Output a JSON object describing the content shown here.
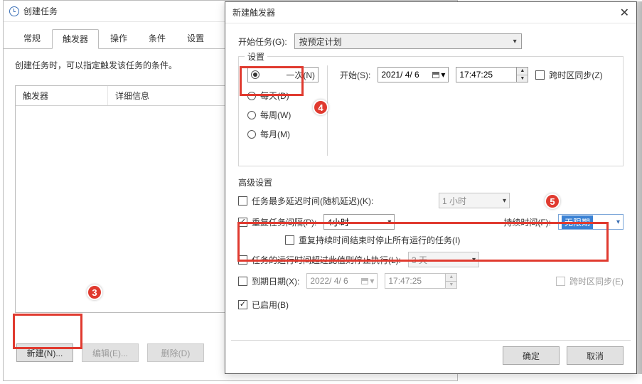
{
  "back": {
    "title": "创建任务",
    "tabs": [
      "常规",
      "触发器",
      "操作",
      "条件",
      "设置"
    ],
    "active_tab": 1,
    "hint": "创建任务时，可以指定触发该任务的条件。",
    "col_trigger": "触发器",
    "col_detail": "详细信息",
    "btn_new": "新建(N)...",
    "btn_edit": "编辑(E)...",
    "btn_delete": "删除(D)"
  },
  "front": {
    "title": "新建触发器",
    "begin_label": "开始任务(G):",
    "begin_value": "按预定计划",
    "settings_legend": "设置",
    "freq": {
      "once": "一次(N)",
      "daily": "每天(D)",
      "weekly": "每周(W)",
      "monthly": "每月(M)"
    },
    "start_label": "开始(S):",
    "start_date": "2021/ 4/ 6",
    "start_time": "17:47:25",
    "cross_tz": "跨时区同步(Z)",
    "adv_title": "高级设置",
    "delay_label": "任务最多延迟时间(随机延迟)(K):",
    "delay_value": "1 小时",
    "repeat_label": "重复任务间隔(P):",
    "repeat_value": "4小时",
    "duration_label": "持续时间(F):",
    "duration_value": "无限期",
    "stop_after_dur": "重复持续时间结束时停止所有运行的任务(I)",
    "stop_if_label": "任务的运行时间超过此值则停止执行(L):",
    "stop_if_value": "3 天",
    "expire_label": "到期日期(X):",
    "expire_date": "2022/ 4/ 6",
    "expire_time": "17:47:25",
    "expire_tz": "跨时区同步(E)",
    "enabled": "已启用(B)",
    "ok": "确定",
    "cancel": "取消"
  },
  "badges": {
    "b3": "3",
    "b4": "4",
    "b5": "5"
  }
}
